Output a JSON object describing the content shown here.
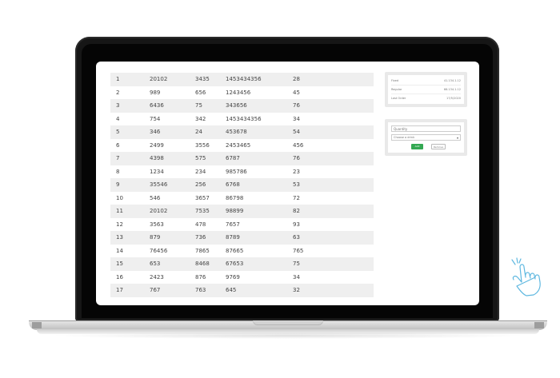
{
  "table": {
    "rows": [
      [
        "1",
        "20102",
        "3435",
        "1453434356",
        "28"
      ],
      [
        "2",
        "989",
        "656",
        "1243456",
        "45"
      ],
      [
        "3",
        "6436",
        "75",
        "343656",
        "76"
      ],
      [
        "4",
        "754",
        "342",
        "1453434356",
        "34"
      ],
      [
        "5",
        "346",
        "24",
        "453678",
        "54"
      ],
      [
        "6",
        "2499",
        "3556",
        "2453465",
        "456"
      ],
      [
        "7",
        "4398",
        "575",
        "6787",
        "76"
      ],
      [
        "8",
        "1234",
        "234",
        "985786",
        "23"
      ],
      [
        "9",
        "35546",
        "256",
        "6768",
        "53"
      ],
      [
        "10",
        "546",
        "3657",
        "86798",
        "72"
      ],
      [
        "11",
        "20102",
        "7535",
        "98899",
        "82"
      ],
      [
        "12",
        "3563",
        "478",
        "7657",
        "93"
      ],
      [
        "13",
        "879",
        "736",
        "8789",
        "63"
      ],
      [
        "14",
        "76456",
        "7865",
        "87665",
        "765"
      ],
      [
        "15",
        "653",
        "8468",
        "67653",
        "75"
      ],
      [
        "16",
        "2423",
        "876",
        "9769",
        "34"
      ],
      [
        "17",
        "767",
        "763",
        "645",
        "32"
      ]
    ]
  },
  "summary": {
    "items": [
      {
        "label": "Fixed",
        "value": "41.134.1.12"
      },
      {
        "label": "Regular",
        "value": "66.134.1.12"
      },
      {
        "label": "Last Order",
        "value": "17/5/2020"
      }
    ]
  },
  "order_form": {
    "quantity_placeholder": "Quantity",
    "select_value": "Choose a drink",
    "add_label": "Add",
    "remove_label": "Remove"
  },
  "colors": {
    "accent_green": "#33a852",
    "stripe": "#efefef",
    "panel_bg": "#e9e9e9"
  }
}
